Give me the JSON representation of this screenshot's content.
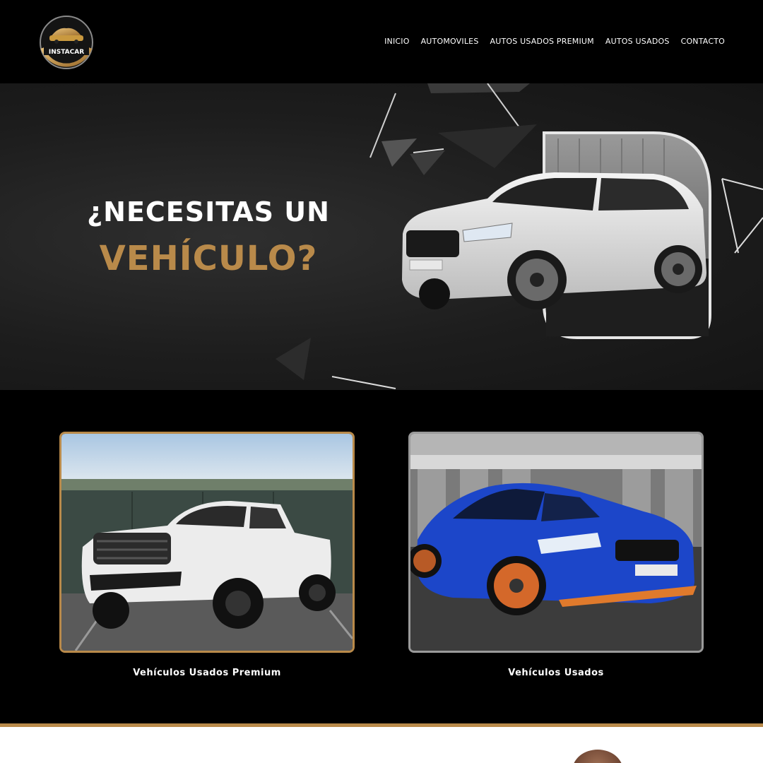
{
  "header": {
    "brand": "INSTACAR",
    "nav": [
      "INICIO",
      "AUTOMOVILES",
      "AUTOS USADOS PREMIUM",
      "AUTOS USADOS",
      "CONTACTO"
    ]
  },
  "hero": {
    "line1": "¿NECESITAS UN",
    "line2": "VEHÍCULO?"
  },
  "cards": [
    {
      "caption": "Vehículos Usados Premium"
    },
    {
      "caption": "Vehículos Usados"
    }
  ],
  "colors": {
    "accent_gold": "#b98a4a",
    "background": "#000000"
  }
}
